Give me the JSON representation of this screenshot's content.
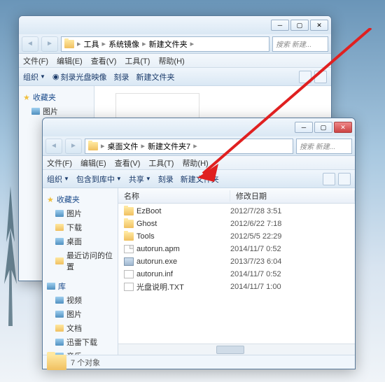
{
  "win1": {
    "breadcrumb": [
      "工具",
      "系统镜像",
      "新建文件夹"
    ],
    "search_placeholder": "搜索 新建...",
    "menu": {
      "file": "文件(F)",
      "edit": "编辑(E)",
      "view": "查看(V)",
      "tools": "工具(T)",
      "help": "帮助(H)"
    },
    "toolbar": {
      "organize": "组织",
      "burn_disc": "刻录光盘映像",
      "burn": "刻录",
      "new_folder": "新建文件夹"
    },
    "sidebar": {
      "favorites": "收藏夹",
      "items": [
        "图片"
      ]
    }
  },
  "win2": {
    "breadcrumb": [
      "桌面文件",
      "新建文件夹7"
    ],
    "search_placeholder": "搜索 新建...",
    "menu": {
      "file": "文件(F)",
      "edit": "编辑(E)",
      "view": "查看(V)",
      "tools": "工具(T)",
      "help": "帮助(H)"
    },
    "toolbar": {
      "organize": "组织",
      "include": "包含到库中",
      "share": "共享",
      "burn": "刻录",
      "new_folder": "新建文件夹"
    },
    "columns": {
      "name": "名称",
      "date": "修改日期"
    },
    "sidebar": {
      "favorites": "收藏夹",
      "fav_items": [
        "图片",
        "下载",
        "桌面",
        "最近访问的位置"
      ],
      "libraries": "库",
      "lib_items": [
        "视频",
        "图片",
        "文档",
        "迅雷下载",
        "音乐"
      ]
    },
    "files": [
      {
        "name": "EzBoot",
        "date": "2012/7/28 3:51",
        "type": "folder"
      },
      {
        "name": "Ghost",
        "date": "2012/6/22 7:18",
        "type": "folder"
      },
      {
        "name": "Tools",
        "date": "2012/5/5 22:29",
        "type": "folder"
      },
      {
        "name": "autorun.apm",
        "date": "2014/11/7 0:52",
        "type": "file"
      },
      {
        "name": "autorun.exe",
        "date": "2013/7/23 6:04",
        "type": "exe"
      },
      {
        "name": "autorun.inf",
        "date": "2014/11/7 0:52",
        "type": "inf"
      },
      {
        "name": "光盘说明.TXT",
        "date": "2014/11/7 1:00",
        "type": "txt"
      }
    ],
    "status": "7 个对象"
  }
}
